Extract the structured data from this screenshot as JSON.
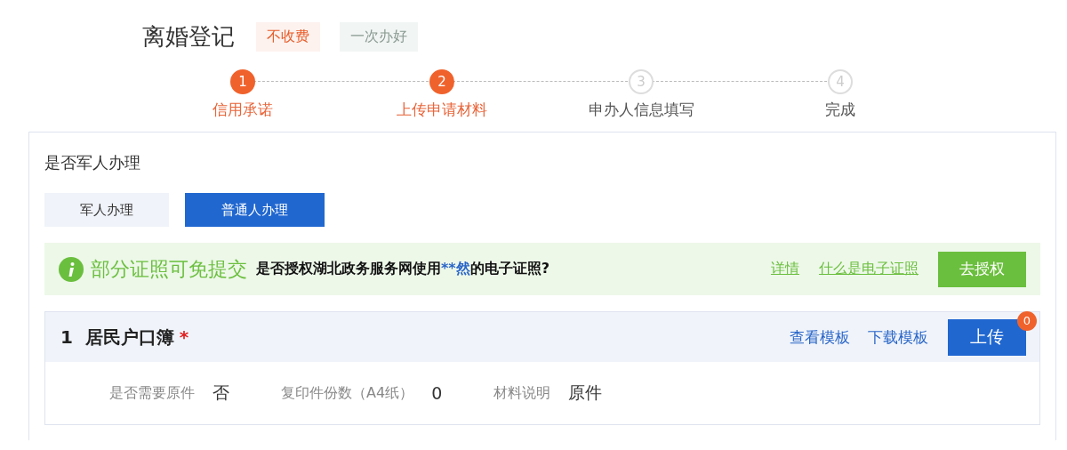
{
  "header": {
    "title": "离婚登记",
    "tags": [
      {
        "label": "不收费",
        "kind": "fee"
      },
      {
        "label": "一次办好",
        "kind": "once"
      }
    ]
  },
  "steps": [
    {
      "number": "1",
      "label": "信用承诺",
      "done": true
    },
    {
      "number": "2",
      "label": "上传申请材料",
      "done": true
    },
    {
      "number": "3",
      "label": "申办人信息填写",
      "done": false
    },
    {
      "number": "4",
      "label": "完成",
      "done": false
    }
  ],
  "applicant": {
    "question": "是否军人办理",
    "options": [
      {
        "label": "军人办理",
        "selected": false
      },
      {
        "label": "普通人办理",
        "selected": true
      }
    ]
  },
  "notice": {
    "headline": "部分证照可免提交",
    "question_start": "是否授权湖北政务服务网使用",
    "name": "**然",
    "question_end": "的电子证照?",
    "links": [
      "详情",
      "什么是电子证照"
    ],
    "button": "去授权"
  },
  "materials": [
    {
      "index": "1",
      "name": "居民户口簿",
      "required_mark": "*",
      "links": [
        "查看模板",
        "下载模板"
      ],
      "upload": "上传",
      "upload_count": "0",
      "fields": [
        {
          "label": "是否需要原件",
          "value": "否"
        },
        {
          "label": "复印件份数（A4纸）",
          "value": "0"
        },
        {
          "label": "材料说明",
          "value": "原件"
        }
      ]
    }
  ]
}
